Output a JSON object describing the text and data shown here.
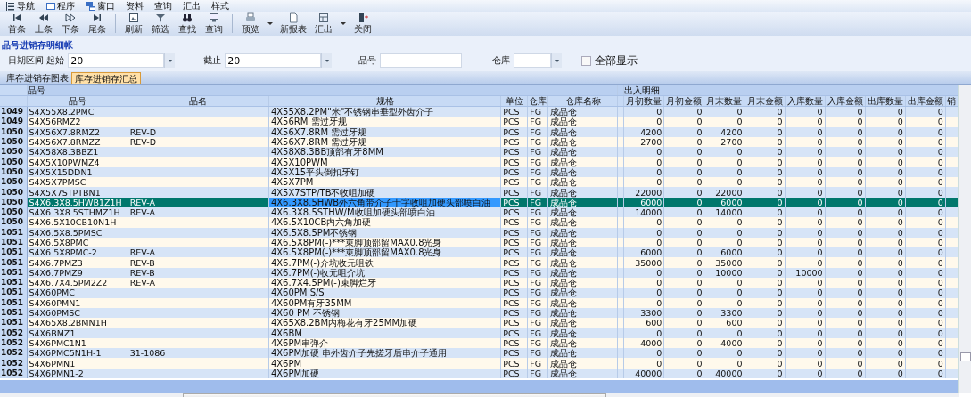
{
  "menu": [
    {
      "label": "导航"
    },
    {
      "label": "程序"
    },
    {
      "label": "窗口"
    },
    {
      "label": "资料"
    },
    {
      "label": "查询"
    },
    {
      "label": "汇出"
    },
    {
      "label": "样式"
    }
  ],
  "toolbar": [
    [
      {
        "label": "首条",
        "dropdown": false
      },
      {
        "label": "上条",
        "dropdown": false
      },
      {
        "label": "下条",
        "dropdown": false
      },
      {
        "label": "尾条",
        "dropdown": false
      }
    ],
    [
      {
        "label": "刷新",
        "dropdown": false
      },
      {
        "label": "筛选",
        "dropdown": false
      },
      {
        "label": "查找",
        "dropdown": false
      },
      {
        "label": "查询",
        "dropdown": false
      }
    ],
    [
      {
        "label": "预览",
        "dropdown": true
      },
      {
        "label": "新报表",
        "dropdown": false
      },
      {
        "label": "汇出",
        "dropdown": true
      },
      {
        "label": "关闭",
        "dropdown": false
      }
    ]
  ],
  "title": "品号进销存明细帐",
  "filters": {
    "date_label": "日期区间 起始",
    "start": "20",
    "end_label": "截止",
    "end": "20",
    "item_label": "品号",
    "warehouse_label": "仓库",
    "show_all": {
      "label": "全部显示",
      "checked": false
    }
  },
  "tabs": [
    {
      "label": "库存进销存图表",
      "selected": false
    },
    {
      "label": "库存进销存汇总",
      "selected": true
    }
  ],
  "table": {
    "groups": [
      {
        "label": "品号"
      },
      {
        "label": "出入明细"
      }
    ],
    "columns": [
      "品号",
      "品名",
      "规格",
      "单位",
      "仓库",
      "仓库名称",
      "月初数量",
      "月初金额",
      "月末数量",
      "月末金额",
      "入库数量",
      "入库金额",
      "出库数量",
      "出库金额",
      "销"
    ],
    "rows": [
      {
        "no": "1049",
        "code": "S4X55X8.2PMC",
        "spec": "4X55X8.2PM\"米\"不锈钢串垂型外齿介子",
        "unit": "PCS",
        "wh": "FG",
        "wh_name": "成品仓",
        "values": [
          "0",
          "0",
          "0",
          "0",
          "0",
          "0",
          "0",
          "0"
        ],
        "selected": false
      },
      {
        "no": "1049",
        "code": "S4X56RMZ2",
        "spec": "4X56RM 需过牙规",
        "unit": "PCS",
        "wh": "FG",
        "wh_name": "成品仓",
        "values": [
          "0",
          "0",
          "0",
          "0",
          "0",
          "0",
          "0",
          "0"
        ],
        "selected": false
      },
      {
        "no": "1050",
        "code": "S4X56X7.8RMZ2",
        "name": "REV-D",
        "spec": "4X56X7.8RM 需过牙规",
        "unit": "PCS",
        "wh": "FG",
        "wh_name": "成品仓",
        "values": [
          "4200",
          "0",
          "4200",
          "0",
          "0",
          "0",
          "0",
          "0"
        ],
        "selected": false
      },
      {
        "no": "1050",
        "code": "S4X56X7.8RMZZ",
        "name": "REV-D",
        "spec": "4X56X7.8RM  需过牙规",
        "unit": "PCS",
        "wh": "FG",
        "wh_name": "成品仓",
        "values": [
          "2700",
          "0",
          "2700",
          "0",
          "0",
          "0",
          "0",
          "0"
        ],
        "selected": false
      },
      {
        "no": "1050",
        "code": "S4X58X8.3BBZ1",
        "spec": "4X58X8.3BB顶部有牙8MM",
        "unit": "PCS",
        "wh": "FG",
        "wh_name": "成品仓",
        "values": [
          "0",
          "0",
          "0",
          "0",
          "0",
          "0",
          "0",
          "0"
        ],
        "selected": false
      },
      {
        "no": "1050",
        "code": "S4X5X10PWMZ4",
        "spec": "4X5X10PWM",
        "unit": "PCS",
        "wh": "FG",
        "wh_name": "成品仓",
        "values": [
          "0",
          "0",
          "0",
          "0",
          "0",
          "0",
          "0",
          "0"
        ],
        "selected": false
      },
      {
        "no": "1050",
        "code": "S4X5X15DDN1",
        "spec": "4X5X15平头倒扣牙钉",
        "unit": "PCS",
        "wh": "FG",
        "wh_name": "成品仓",
        "values": [
          "0",
          "0",
          "0",
          "0",
          "0",
          "0",
          "0",
          "0"
        ],
        "selected": false
      },
      {
        "no": "1050",
        "code": "S4X5X7PMSC",
        "spec": "4X5X7PM",
        "unit": "PCS",
        "wh": "FG",
        "wh_name": "成品仓",
        "values": [
          "0",
          "0",
          "0",
          "0",
          "0",
          "0",
          "0",
          "0"
        ],
        "selected": false
      },
      {
        "no": "1050",
        "code": "S4X5X7STPTBN1",
        "spec": "4X5X7STP/TB不收咀加硬",
        "unit": "PCS",
        "wh": "FG",
        "wh_name": "成品仓",
        "values": [
          "22000",
          "0",
          "22000",
          "0",
          "0",
          "0",
          "0",
          "0"
        ],
        "selected": false
      },
      {
        "no": "1050",
        "code": "S4X6.3X8.5HWB1Z1H",
        "name": "REV-A",
        "spec": "4X6.3X8.5HWB外六角带介子十字收咀加硬头部喷白油",
        "unit": "PCS",
        "wh": "FG",
        "wh_name": "成品仓",
        "values": [
          "6000",
          "0",
          "6000",
          "0",
          "0",
          "0",
          "0",
          "0"
        ],
        "selected": true
      },
      {
        "no": "1050",
        "code": "S4X6.3X8.5STHMZ1H",
        "name": "REV-A",
        "spec": "4X6.3X8.5STHW/M收咀加硬头部喷白油",
        "unit": "PCS",
        "wh": "FG",
        "wh_name": "成品仓",
        "values": [
          "14000",
          "0",
          "14000",
          "0",
          "0",
          "0",
          "0",
          "0"
        ],
        "selected": false
      },
      {
        "no": "1050",
        "code": "S4X6.5X10CB10N1H",
        "spec": "4X6.5X10CB内六角加硬",
        "unit": "PCS",
        "wh": "FG",
        "wh_name": "成品仓",
        "values": [
          "0",
          "0",
          "0",
          "0",
          "0",
          "0",
          "0",
          "0"
        ],
        "selected": false
      },
      {
        "no": "1051",
        "code": "S4X6.5X8.5PMSC",
        "spec": "4X6.5X8.5PM不锈钢",
        "unit": "PCS",
        "wh": "FG",
        "wh_name": "成品仓",
        "values": [
          "0",
          "0",
          "0",
          "0",
          "0",
          "0",
          "0",
          "0"
        ],
        "selected": false
      },
      {
        "no": "1051",
        "code": "S4X6.5X8PMC",
        "spec": "4X6.5X8PM(-)***束脚顶部留MAX0.8光身",
        "unit": "PCS",
        "wh": "FG",
        "wh_name": "成品仓",
        "values": [
          "0",
          "0",
          "0",
          "0",
          "0",
          "0",
          "0",
          "0"
        ],
        "selected": false
      },
      {
        "no": "1051",
        "code": "S4X6.5X8PMC-2",
        "name": "REV-A",
        "spec": "4X6.5X8PM(-)***束脚顶部留MAX0.8光身",
        "unit": "PCS",
        "wh": "FG",
        "wh_name": "成品仓",
        "values": [
          "6000",
          "0",
          "6000",
          "0",
          "0",
          "0",
          "0",
          "0"
        ],
        "selected": false
      },
      {
        "no": "1051",
        "code": "S4X6.7PMZ3",
        "name": "REV-B",
        "spec": "4X6.7PM(-)介坑收元咀铁",
        "unit": "PCS",
        "wh": "FG",
        "wh_name": "成品仓",
        "values": [
          "35000",
          "0",
          "35000",
          "0",
          "0",
          "0",
          "0",
          "0"
        ],
        "selected": false
      },
      {
        "no": "1051",
        "code": "S4X6.7PMZ9",
        "name": "REV-B",
        "spec": "4X6.7PM(-)收元咀介坑",
        "unit": "PCS",
        "wh": "FG",
        "wh_name": "成品仓",
        "values": [
          "0",
          "0",
          "10000",
          "0",
          "10000",
          "0",
          "0",
          "0"
        ],
        "selected": false
      },
      {
        "no": "1051",
        "code": "S4X6.7X4.5PM2Z2",
        "name": "REV-A",
        "spec": "4X6.7X4.5PM(-)束脚烂牙",
        "unit": "PCS",
        "wh": "FG",
        "wh_name": "成品仓",
        "values": [
          "0",
          "0",
          "0",
          "0",
          "0",
          "0",
          "0",
          "0"
        ],
        "selected": false
      },
      {
        "no": "1051",
        "code": "S4X60PMC",
        "spec": "4X60PM  S/S",
        "unit": "PCS",
        "wh": "FG",
        "wh_name": "成品仓",
        "values": [
          "0",
          "0",
          "0",
          "0",
          "0",
          "0",
          "0",
          "0"
        ],
        "selected": false
      },
      {
        "no": "1051",
        "code": "S4X60PMN1",
        "spec": "4X60PM有牙35MM",
        "unit": "PCS",
        "wh": "FG",
        "wh_name": "成品仓",
        "values": [
          "0",
          "0",
          "0",
          "0",
          "0",
          "0",
          "0",
          "0"
        ],
        "selected": false
      },
      {
        "no": "1051",
        "code": "S4X60PMSC",
        "spec": "4X60  PM 不锈钢",
        "unit": "PCS",
        "wh": "FG",
        "wh_name": "成品仓",
        "values": [
          "3300",
          "0",
          "3300",
          "0",
          "0",
          "0",
          "0",
          "0"
        ],
        "selected": false
      },
      {
        "no": "1051",
        "code": "S4X65X8.2BMN1H",
        "spec": "4X65X8.2BM内梅花有牙25MM加硬",
        "unit": "PCS",
        "wh": "FG",
        "wh_name": "成品仓",
        "values": [
          "600",
          "0",
          "600",
          "0",
          "0",
          "0",
          "0",
          "0"
        ],
        "selected": false
      },
      {
        "no": "1052",
        "code": "S4X6BMZ1",
        "spec": "4X6BM",
        "unit": "PCS",
        "wh": "FG",
        "wh_name": "成品仓",
        "values": [
          "0",
          "0",
          "0",
          "0",
          "0",
          "0",
          "0",
          "0"
        ],
        "selected": false
      },
      {
        "no": "1052",
        "code": "S4X6PMC1N1",
        "spec": "4X6PM串弹介",
        "unit": "PCS",
        "wh": "FG",
        "wh_name": "成品仓",
        "values": [
          "4000",
          "0",
          "4000",
          "0",
          "0",
          "0",
          "0",
          "0"
        ],
        "selected": false
      },
      {
        "no": "1052",
        "code": "S4X6PMC5N1H-1",
        "name": "31-1086",
        "spec": "4X6PM加硬 串外齿介子先搓牙后串介子通用",
        "unit": "PCS",
        "wh": "FG",
        "wh_name": "成品仓",
        "values": [
          "0",
          "0",
          "0",
          "0",
          "0",
          "0",
          "0",
          "0"
        ],
        "selected": false
      },
      {
        "no": "1052",
        "code": "S4X6PMN1",
        "spec": "4X6PM",
        "unit": "PCS",
        "wh": "FG",
        "wh_name": "成品仓",
        "values": [
          "0",
          "0",
          "0",
          "0",
          "0",
          "0",
          "0",
          "0"
        ],
        "selected": false
      },
      {
        "no": "1052",
        "code": "S4X6PMN1-2",
        "spec": "4X6PM加硬",
        "unit": "PCS",
        "wh": "FG",
        "wh_name": "成品仓",
        "values": [
          "40000",
          "0",
          "40000",
          "0",
          "0",
          "0",
          "0",
          "0"
        ],
        "selected": false
      }
    ]
  }
}
